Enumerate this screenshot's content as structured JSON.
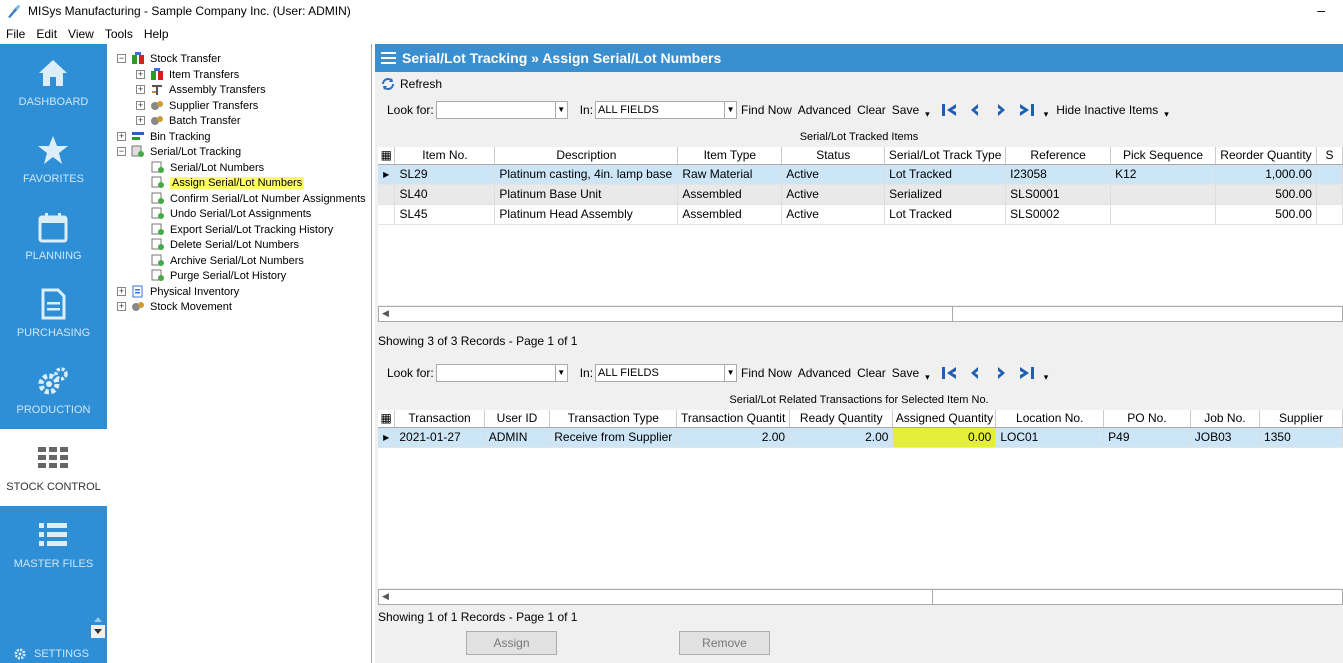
{
  "window": {
    "title": "MISys Manufacturing - Sample Company Inc. (User: ADMIN)",
    "minimize": "–"
  },
  "menu": [
    "File",
    "Edit",
    "View",
    "Tools",
    "Help"
  ],
  "nav": {
    "items": [
      {
        "label": "DASHBOARD",
        "icon": "home-icon"
      },
      {
        "label": "FAVORITES",
        "icon": "star-icon"
      },
      {
        "label": "PLANNING",
        "icon": "calendar-icon"
      },
      {
        "label": "PURCHASING",
        "icon": "document-icon"
      },
      {
        "label": "PRODUCTION",
        "icon": "gears-icon"
      },
      {
        "label": "STOCK CONTROL",
        "icon": "grid-icon"
      },
      {
        "label": "MASTER FILES",
        "icon": "list-icon"
      }
    ],
    "settings": "SETTINGS",
    "active": "STOCK CONTROL"
  },
  "tree": [
    {
      "label": "Stock Transfer",
      "level": 0,
      "expander": "−"
    },
    {
      "label": "Item Transfers",
      "level": 1,
      "expander": "+"
    },
    {
      "label": "Assembly Transfers",
      "level": 1,
      "expander": "+"
    },
    {
      "label": "Supplier Transfers",
      "level": 1,
      "expander": "+"
    },
    {
      "label": "Batch Transfer",
      "level": 1,
      "expander": "+"
    },
    {
      "label": "Bin Tracking",
      "level": 0,
      "expander": "+"
    },
    {
      "label": "Serial/Lot Tracking",
      "level": 0,
      "expander": "−"
    },
    {
      "label": "Serial/Lot Numbers",
      "level": 2
    },
    {
      "label": "Assign Serial/Lot Numbers",
      "level": 2,
      "selected": true
    },
    {
      "label": "Confirm Serial/Lot Number Assignments",
      "level": 2
    },
    {
      "label": "Undo Serial/Lot Assignments",
      "level": 2
    },
    {
      "label": "Export Serial/Lot Tracking History",
      "level": 2
    },
    {
      "label": "Delete Serial/Lot Numbers",
      "level": 2
    },
    {
      "label": "Archive Serial/Lot Numbers",
      "level": 2
    },
    {
      "label": "Purge Serial/Lot History",
      "level": 2
    },
    {
      "label": "Physical Inventory",
      "level": 0,
      "expander": "+"
    },
    {
      "label": "Stock Movement",
      "level": 0,
      "expander": "+"
    }
  ],
  "main": {
    "title": "Serial/Lot Tracking » Assign Serial/Lot Numbers",
    "refresh": "Refresh",
    "toolbar": {
      "look_for": "Look for:",
      "in": "In:",
      "in_value": "ALL FIELDS",
      "find_now": "Find Now",
      "advanced": "Advanced",
      "clear": "Clear",
      "save": "Save",
      "hide_inactive": "Hide Inactive Items"
    },
    "items_caption": "Serial/Lot Tracked Items",
    "items_columns": [
      "Item No.",
      "Description",
      "Item Type",
      "Status",
      "Serial/Lot Track Type",
      "Reference",
      "Pick Sequence",
      "Reorder Quantity",
      "S"
    ],
    "items_rows": [
      [
        "SL29",
        "Platinum casting, 4in. lamp base",
        "Raw Material",
        "Active",
        "Lot Tracked",
        "I23058",
        "K12",
        "1,000.00"
      ],
      [
        "SL40",
        "Platinum Base Unit",
        "Assembled",
        "Active",
        "Serialized",
        "SLS0001",
        "",
        "500.00"
      ],
      [
        "SL45",
        "Platinum Head Assembly",
        "Assembled",
        "Active",
        "Lot Tracked",
        "SLS0002",
        "",
        "500.00"
      ]
    ],
    "items_status": "Showing 3 of 3 Records - Page 1 of 1",
    "trans_caption": "Serial/Lot Related Transactions for Selected Item No.",
    "trans_columns": [
      "Transaction",
      "User ID",
      "Transaction Type",
      "Transaction Quantit",
      "Ready Quantity",
      "Assigned Quantity",
      "Location No.",
      "PO No.",
      "Job No.",
      "Supplier"
    ],
    "trans_rows": [
      [
        "2021-01-27",
        "ADMIN",
        "Receive from Supplier",
        "2.00",
        "2.00",
        "0.00",
        "LOC01",
        "P49",
        "JOB03",
        "1350"
      ]
    ],
    "trans_status": "Showing 1 of 1 Records - Page 1 of 1",
    "buttons": {
      "assign": "Assign",
      "remove": "Remove"
    }
  },
  "colors": {
    "nav_bg": "#2e8fd6",
    "header_bg": "#3a8fd0",
    "highlight": "#ffff66",
    "selected_row": "#cde6f7"
  }
}
